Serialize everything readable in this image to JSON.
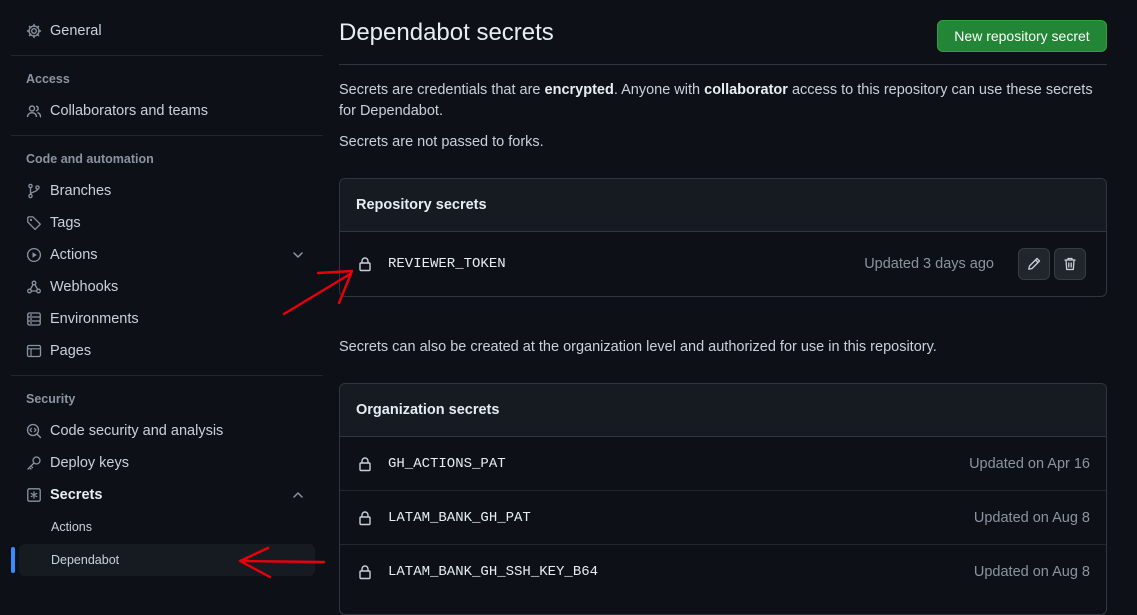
{
  "sidebar": {
    "general": "General",
    "access_title": "Access",
    "collaborators": "Collaborators and teams",
    "code_title": "Code and automation",
    "branches": "Branches",
    "tags": "Tags",
    "actions": "Actions",
    "webhooks": "Webhooks",
    "environments": "Environments",
    "pages": "Pages",
    "security_title": "Security",
    "code_security": "Code security and analysis",
    "deploy_keys": "Deploy keys",
    "secrets": "Secrets",
    "secrets_sub": [
      "Actions",
      "Dependabot"
    ]
  },
  "main": {
    "title": "Dependabot secrets",
    "new_button": "New repository secret",
    "intro": {
      "t1": "Secrets are credentials that are ",
      "b1": "encrypted",
      "t2": ". Anyone with ",
      "b2": "collaborator",
      "t3": " access to this repository can use these secrets for Dependabot."
    },
    "no_forks": "Secrets are not passed to forks.",
    "repo_header": "Repository secrets",
    "repo_secret": {
      "name": "REVIEWER_TOKEN",
      "updated": "Updated 3 days ago"
    },
    "org_note": "Secrets can also be created at the organization level and authorized for use in this repository.",
    "org_header": "Organization secrets",
    "org_secrets": [
      {
        "name": "GH_ACTIONS_PAT",
        "updated": "Updated on Apr 16"
      },
      {
        "name": "LATAM_BANK_GH_PAT",
        "updated": "Updated on Aug 8"
      },
      {
        "name": "LATAM_BANK_GH_SSH_KEY_B64",
        "updated": "Updated on Aug 8"
      }
    ]
  },
  "colors": {
    "background": "#0d1117",
    "accent_green": "#238636",
    "active_indicator": "#388bfd",
    "annotation_red": "#e8000b"
  }
}
